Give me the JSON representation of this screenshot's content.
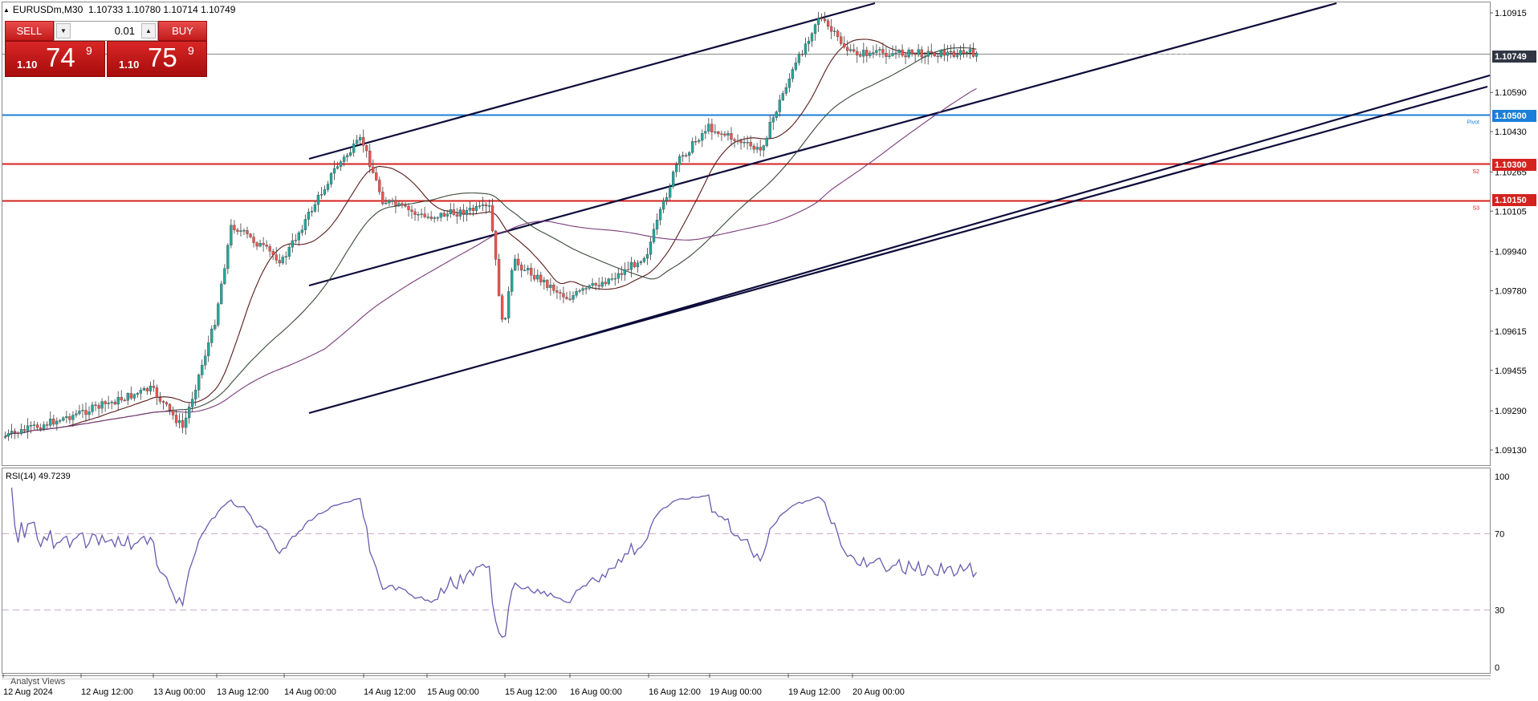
{
  "header": {
    "symbol": "EURUSDm,M30",
    "ohlc": "1.10733 1.10780 1.10714 1.10749"
  },
  "trade_panel": {
    "sell_label": "SELL",
    "buy_label": "BUY",
    "lot_value": "0.01",
    "sell_price": {
      "prefix": "1.10",
      "big": "74",
      "sup": "9"
    },
    "buy_price": {
      "prefix": "1.10",
      "big": "75",
      "sup": "9"
    }
  },
  "price_axis": {
    "ticks": [
      "1.10915",
      "1.10590",
      "1.10430",
      "1.10265",
      "1.10105",
      "1.09940",
      "1.09780",
      "1.09615",
      "1.09455",
      "1.09290",
      "1.09130"
    ]
  },
  "price_tags": {
    "current": "1.10749",
    "pivot": "1.10500",
    "s2": "1.10300",
    "s3": "1.10150"
  },
  "level_labels": {
    "pivot": "Pivot",
    "s2": "S2",
    "s3": "S3"
  },
  "level_colors": {
    "pivot": "#1c7fd7",
    "support": "#d4231f",
    "current": "#303642",
    "rsi_line": "#6a5bb0"
  },
  "time_axis": {
    "labels": [
      "12 Aug 2024",
      "12 Aug 12:00",
      "13 Aug 00:00",
      "13 Aug 12:00",
      "14 Aug 00:00",
      "14 Aug 12:00",
      "15 Aug 00:00",
      "15 Aug 12:00",
      "16 Aug 00:00",
      "16 Aug 12:00",
      "19 Aug 00:00",
      "19 Aug 12:00",
      "20 Aug 00:00"
    ]
  },
  "rsi": {
    "title": "RSI(14) 49.7239",
    "axis_labels": [
      "100",
      "70",
      "30",
      "0"
    ]
  },
  "footer": {
    "analyst_views": "Analyst Views"
  },
  "chart_data": {
    "type": "candlestick",
    "symbol": "EURUSDm",
    "timeframe": "M30",
    "ylim": [
      1.0905,
      1.1099
    ],
    "close_path": [
      {
        "t": "12 Aug 2024",
        "price": 1.0918
      },
      {
        "t": "12 Aug 12:00",
        "price": 1.0928
      },
      {
        "t": "13 Aug 00:00",
        "price": 1.0938
      },
      {
        "t": "13 Aug 06:00",
        "price": 1.0922
      },
      {
        "t": "13 Aug 12:00",
        "price": 1.0965
      },
      {
        "t": "13 Aug 15:00",
        "price": 1.1005
      },
      {
        "t": "14 Aug 00:00",
        "price": 1.099
      },
      {
        "t": "14 Aug 08:00",
        "price": 1.1028
      },
      {
        "t": "14 Aug 12:00",
        "price": 1.104
      },
      {
        "t": "14 Aug 16:00",
        "price": 1.1015
      },
      {
        "t": "15 Aug 00:00",
        "price": 1.1008
      },
      {
        "t": "15 Aug 10:00",
        "price": 1.1012
      },
      {
        "t": "15 Aug 12:00",
        "price": 1.0962
      },
      {
        "t": "15 Aug 14:00",
        "price": 1.099
      },
      {
        "t": "16 Aug 00:00",
        "price": 1.0975
      },
      {
        "t": "16 Aug 08:00",
        "price": 1.0985
      },
      {
        "t": "16 Aug 12:00",
        "price": 1.0993
      },
      {
        "t": "16 Aug 18:00",
        "price": 1.103
      },
      {
        "t": "19 Aug 00:00",
        "price": 1.1045
      },
      {
        "t": "19 Aug 08:00",
        "price": 1.1035
      },
      {
        "t": "19 Aug 12:00",
        "price": 1.1062
      },
      {
        "t": "19 Aug 18:00",
        "price": 1.109
      },
      {
        "t": "20 Aug 00:00",
        "price": 1.1075
      }
    ],
    "rsi_ylim": [
      0,
      100
    ],
    "rsi_levels": [
      70,
      30
    ],
    "rsi_last": 49.7239
  }
}
